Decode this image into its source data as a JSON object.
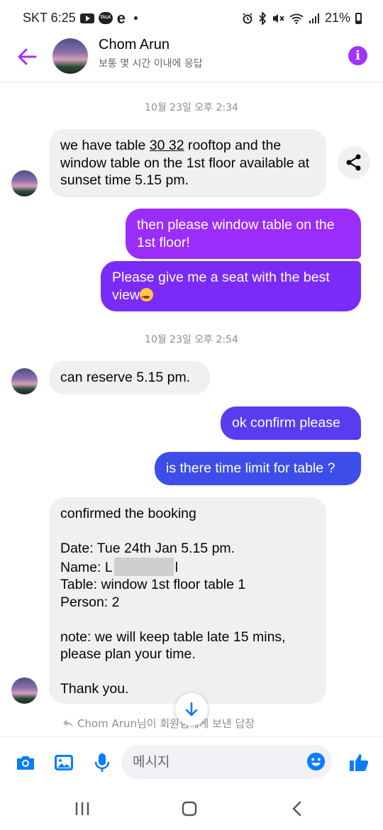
{
  "status_bar": {
    "carrier_time": "SKT 6:25",
    "talk_badge": "TALK",
    "battery": "21%",
    "icons": [
      "youtube-icon",
      "kakaotalk-icon",
      "browser-e-icon",
      "alarm-icon",
      "bluetooth-icon",
      "mute-icon",
      "wifi-icon",
      "signal-icon",
      "battery-icon"
    ]
  },
  "header": {
    "contact_name": "Chom Arun",
    "contact_status": "보통 몇 시간 이내에 응답",
    "info_glyph": "i",
    "accent_color": "#a033ff"
  },
  "chat": {
    "timestamps": [
      "10월 23일 오후 2:34",
      "10월 23일 오후 2:54"
    ],
    "msg1": {
      "pre": "we have table ",
      "linked": "30 32",
      "post": " rooftop and the window table on the 1st floor available at sunset time 5.15 pm."
    },
    "msg2": "then please window table on the 1st floor!",
    "msg3": "Please give me a seat with the best view",
    "msg3_emoji": "star-struck-emoji",
    "msg4": "can reserve 5.15 pm.",
    "msg5": "ok confirm please",
    "msg6": "is there time limit for table ?",
    "msg7": {
      "line1": "confirmed the booking",
      "date": "Date: Tue 24th Jan 5.15 pm.",
      "name_prefix": "Name: L",
      "name_suffix": "l",
      "table": "Table: window 1st floor table 1",
      "person": "Person: 2",
      "note": "note: we will keep table late 15 mins, please plan your time.",
      "thanks": "Thank you."
    },
    "reply_hint": "Chom Arun님이 회원님에게 보낸 답장"
  },
  "composer": {
    "placeholder": "메시지",
    "icons": [
      "camera-icon",
      "gallery-icon",
      "microphone-icon",
      "emoji-icon",
      "thumbs-up-icon"
    ]
  },
  "colors": {
    "incoming_bg": "#f0f0f0",
    "outgoing_purple": "#9b2dfa",
    "outgoing_violet": "#7a2bf7",
    "outgoing_blue": "#3d4de8",
    "icon_blue": "#0a7cff"
  }
}
